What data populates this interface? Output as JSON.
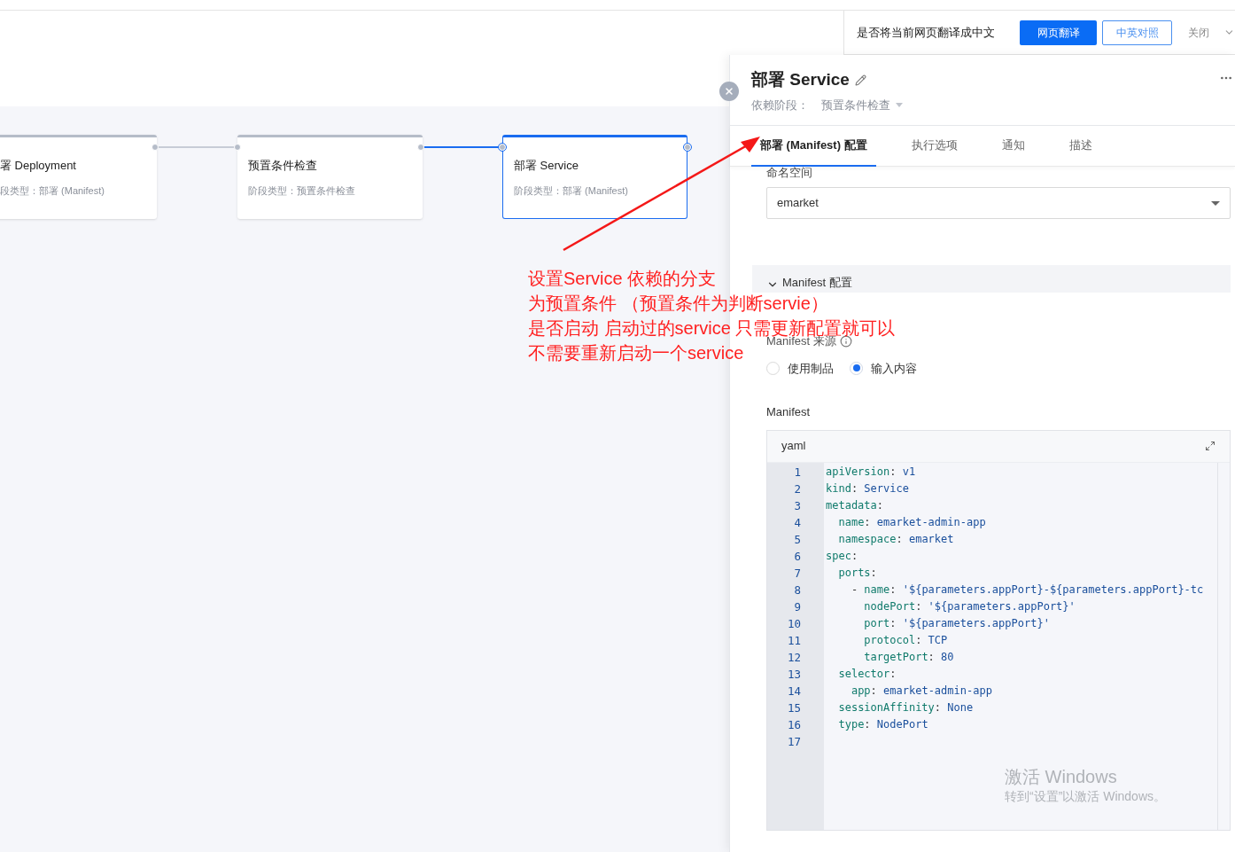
{
  "translate_bar": {
    "prompt": "是否将当前网页翻译成中文",
    "buttons": [
      {
        "label": "网页翻译",
        "kind": "primary"
      },
      {
        "label": "中英对照",
        "kind": "outline"
      }
    ],
    "close": "关闭"
  },
  "pipeline": {
    "stages": [
      {
        "title": "署 Deployment",
        "type": "段类型：部署 (Manifest)",
        "selected": false
      },
      {
        "title": "预置条件检查",
        "type": "阶段类型：预置条件检查",
        "selected": false
      },
      {
        "title": "部署 Service",
        "type": "阶段类型：部署 (Manifest)",
        "selected": true
      }
    ]
  },
  "drawer": {
    "title": "部署 Service",
    "dependency_label": "依赖阶段：",
    "dependency_value": "预置条件检查",
    "tabs": [
      {
        "label": "部署 (Manifest) 配置",
        "selected": true
      },
      {
        "label": "执行选项",
        "selected": false
      },
      {
        "label": "通知",
        "selected": false
      },
      {
        "label": "描述",
        "selected": false
      }
    ],
    "namespace": {
      "label": "命名空间",
      "value": "emarket"
    },
    "section": {
      "title": "Manifest 配置",
      "expanded": true
    },
    "source": {
      "label": "Manifest 来源",
      "options": [
        {
          "label": "使用制品",
          "selected": false
        },
        {
          "label": "输入内容",
          "selected": true
        }
      ]
    },
    "manifest": {
      "label": "Manifest",
      "language": "yaml",
      "lines": [
        {
          "number": "1",
          "text": "apiVersion: v1"
        },
        {
          "number": "2",
          "text": "kind: Service"
        },
        {
          "number": "3",
          "text": "metadata:"
        },
        {
          "number": "4",
          "text": "  name: emarket-admin-app"
        },
        {
          "number": "5",
          "text": "  namespace: emarket"
        },
        {
          "number": "6",
          "text": "spec:"
        },
        {
          "number": "7",
          "text": "  ports:"
        },
        {
          "number": "8",
          "text": "    - name: '${parameters.appPort}-${parameters.appPort}-tc"
        },
        {
          "number": "9",
          "text": "      nodePort: '${parameters.appPort}'"
        },
        {
          "number": "10",
          "text": "      port: '${parameters.appPort}'"
        },
        {
          "number": "11",
          "text": "      protocol: TCP"
        },
        {
          "number": "12",
          "text": "      targetPort: 80"
        },
        {
          "number": "13",
          "text": "  selector:"
        },
        {
          "number": "14",
          "text": "    app: emarket-admin-app"
        },
        {
          "number": "15",
          "text": "  sessionAffinity: None"
        },
        {
          "number": "16",
          "text": "  type: NodePort"
        },
        {
          "number": "17"
        }
      ]
    }
  },
  "annotation": {
    "lines": [
      "设置Service 依赖的分支",
      "为预置条件 （预置条件为判断servie）",
      "是否启动 启动过的service 只需更新配置就可以",
      "不需要重新启动一个service"
    ]
  },
  "os_notice": {
    "title": "激活 Windows",
    "subtitle": "转到“设置”以激活 Windows。"
  }
}
